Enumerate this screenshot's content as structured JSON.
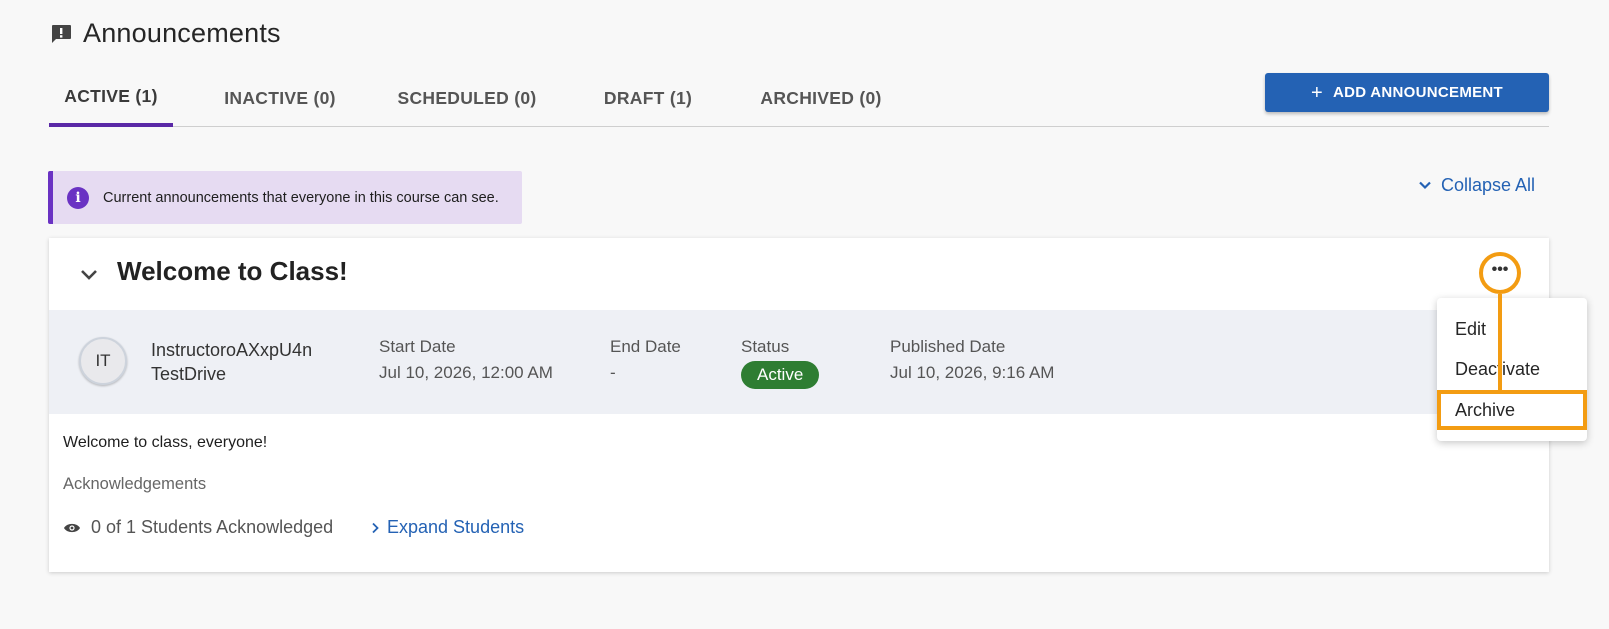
{
  "page": {
    "title": "Announcements",
    "title_icon": "announcement-icon"
  },
  "tabs": [
    {
      "label": "ACTIVE (1)",
      "active": true
    },
    {
      "label": "INACTIVE (0)",
      "active": false
    },
    {
      "label": "SCHEDULED (0)",
      "active": false
    },
    {
      "label": "DRAFT (1)",
      "active": false
    },
    {
      "label": "ARCHIVED (0)",
      "active": false
    }
  ],
  "add_button": {
    "label": "ADD ANNOUNCEMENT",
    "icon": "plus-icon"
  },
  "info_banner": {
    "text": "Current announcements that everyone in this course can see.",
    "icon": "info-icon"
  },
  "collapse_all": {
    "label": "Collapse All",
    "icon": "chevron-down-icon"
  },
  "announcement": {
    "title": "Welcome to Class!",
    "author": {
      "initials": "IT",
      "first_line": "InstructoroAXxpU4n",
      "second_line": "TestDrive"
    },
    "start_date": {
      "label": "Start Date",
      "value": "Jul 10, 2026, 12:00 AM"
    },
    "end_date": {
      "label": "End Date",
      "value": "-"
    },
    "status": {
      "label": "Status",
      "value": "Active"
    },
    "published_date": {
      "label": "Published Date",
      "value": "Jul 10, 2026, 9:16 AM"
    },
    "body": "Welcome to class, everyone!",
    "acknowledgements": {
      "heading": "Acknowledgements",
      "count_text": "0 of 1 Students Acknowledged",
      "expand_label": "Expand Students"
    }
  },
  "menu": {
    "icon": "more-options-icon",
    "items": [
      "Edit",
      "Deactivate",
      "Archive"
    ]
  },
  "colors": {
    "accent_purple": "#5a28a6",
    "primary_blue": "#2462b4",
    "status_green": "#2e7d32",
    "highlight_orange": "#f39c12"
  }
}
